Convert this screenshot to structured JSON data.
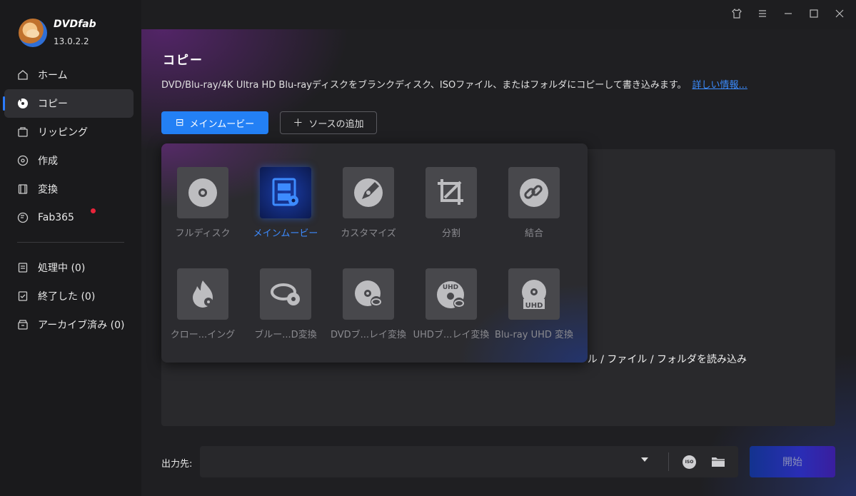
{
  "app": {
    "name": "DVDfab",
    "version": "13.0.2.2"
  },
  "sidebar": {
    "items": [
      {
        "label": "ホーム",
        "icon": "home-icon"
      },
      {
        "label": "コピー",
        "icon": "copy-disc-icon",
        "active": true
      },
      {
        "label": "リッピング",
        "icon": "ripper-icon"
      },
      {
        "label": "作成",
        "icon": "creator-icon"
      },
      {
        "label": "変換",
        "icon": "converter-icon"
      },
      {
        "label": "Fab365",
        "icon": "fab365-icon",
        "badge": "notification-dot"
      }
    ],
    "tasks": [
      {
        "label": "処理中 (0)",
        "icon": "processing-icon"
      },
      {
        "label": "終了した (0)",
        "icon": "finished-icon"
      },
      {
        "label": "アーカイブ済み (0)",
        "icon": "archive-icon"
      }
    ]
  },
  "titlebar": {
    "icons": [
      "skin-icon",
      "menu-icon",
      "minimize-icon",
      "maximize-icon",
      "close-icon"
    ]
  },
  "main": {
    "title": "コピー",
    "description": "DVD/Blu-ray/4K Ultra HD Blu-rayディスクをブランクディスク、ISOファイル、またはフォルダにコピーして書き込みます。",
    "more_link": "詳しい情報...",
    "mode_button": "メインムービー",
    "add_source_button": "ソースの追加",
    "drop_hint": "ル / ファイル / フォルダを読み込み",
    "modes": [
      {
        "label": "フルディスク",
        "icon": "full-disc-icon"
      },
      {
        "label": "メインムービー",
        "icon": "main-movie-icon",
        "active": true
      },
      {
        "label": "カスタマイズ",
        "icon": "customize-icon"
      },
      {
        "label": "分割",
        "icon": "split-icon"
      },
      {
        "label": "結合",
        "icon": "merge-icon"
      },
      {
        "label": "クロー...イング",
        "icon": "clone-burn-icon"
      },
      {
        "label": "ブルー...D変換",
        "icon": "bluray-to-dvd-icon"
      },
      {
        "label": "DVDブ...レイ変換",
        "icon": "dvd-to-bluray-icon"
      },
      {
        "label": "UHDブ...レイ変換",
        "icon": "uhd-to-bluray-icon"
      },
      {
        "label": "Blu-ray UHD 変換",
        "icon": "bluray-to-uhd-icon"
      }
    ]
  },
  "output": {
    "label": "出力先:",
    "iso_label": "ISO",
    "start_button": "開始"
  },
  "colors": {
    "accent": "#2380f5",
    "active_label": "#3d8bff",
    "notification": "#e8243a"
  }
}
